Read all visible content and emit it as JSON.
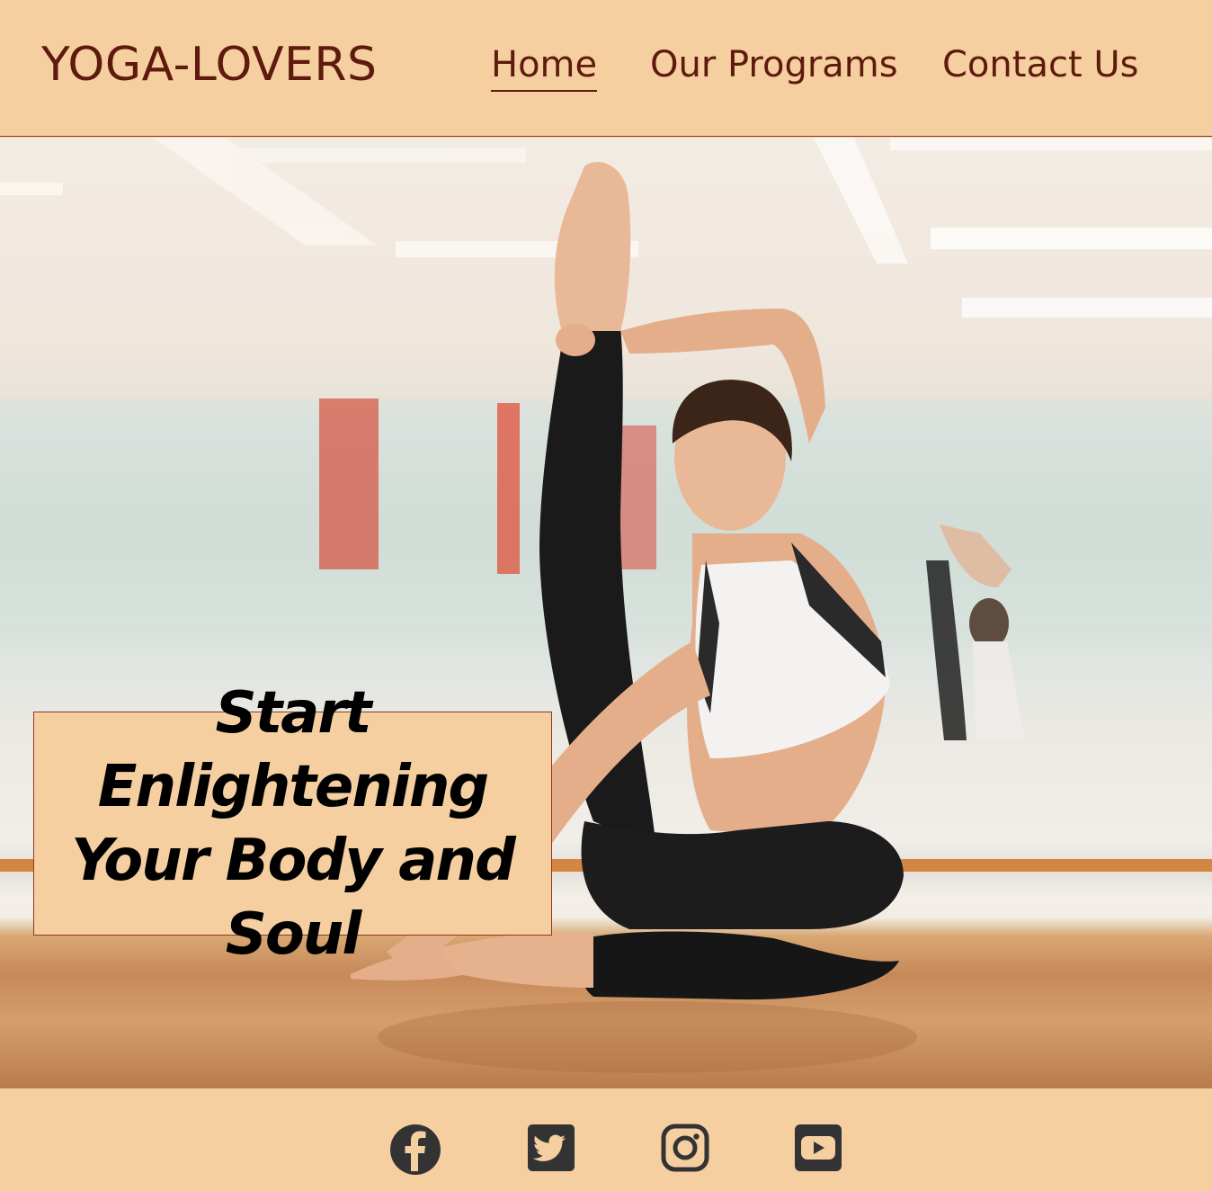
{
  "header": {
    "brand": "YOGA-LOVERS",
    "nav": [
      {
        "label": "Home",
        "active": true
      },
      {
        "label": "Our Programs",
        "active": false
      },
      {
        "label": "Contact Us",
        "active": false
      }
    ]
  },
  "hero": {
    "tagline": "Start Enlightening Your Body and Soul",
    "image": "woman-doing-yoga-in-studio"
  },
  "footer": {
    "social": [
      {
        "name": "facebook-icon"
      },
      {
        "name": "twitter-icon"
      },
      {
        "name": "instagram-icon"
      },
      {
        "name": "youtube-icon"
      }
    ]
  },
  "colors": {
    "header_bg": "#f6cfa1",
    "brand_text": "#5e1a0d",
    "icon": "#333333"
  }
}
